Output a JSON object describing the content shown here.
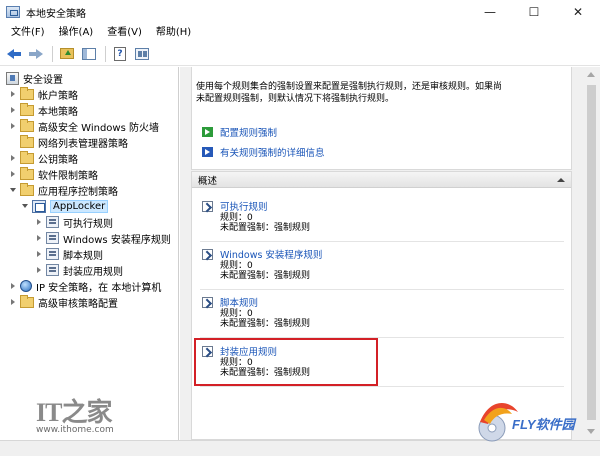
{
  "window": {
    "title": "本地安全策略",
    "minimize": "—",
    "maximize": "☐",
    "close": "✕"
  },
  "menu": [
    "文件(F)",
    "操作(A)",
    "查看(V)",
    "帮助(H)"
  ],
  "tree": {
    "root": "安全设置",
    "items": [
      "帐户策略",
      "本地策略",
      "高级安全 Windows 防火墙",
      "网络列表管理器策略",
      "公钥策略",
      "软件限制策略",
      "应用程序控制策略",
      "AppLocker",
      "可执行规则",
      "Windows 安装程序规则",
      "脚本规则",
      "封装应用规则",
      "IP 安全策略，在 本地计算机",
      "高级审核策略配置"
    ]
  },
  "description": {
    "line1": "使用每个规则集合的强制设置来配置是强制执行规则，还是审核规则。如果尚",
    "line2": "未配置规则强制，则默认情况下将强制执行规则。",
    "link_configure": "配置规则强制",
    "link_more": "有关规则强制的详细信息"
  },
  "overview": {
    "header": "概述",
    "rules": [
      {
        "title": "可执行规则",
        "count": "规则：0",
        "enforce": "未配置强制：强制规则"
      },
      {
        "title": "Windows 安装程序规则",
        "count": "规则：0",
        "enforce": "未配置强制：强制规则"
      },
      {
        "title": "脚本规则",
        "count": "规则：0",
        "enforce": "未配置强制：强制规则"
      },
      {
        "title": "封装应用规则",
        "count": "规则：0",
        "enforce": "未配置强制：强制规则"
      }
    ]
  },
  "watermark": {
    "it": "IT之家",
    "url": "www.ithome.com",
    "fly": "FLY软件园"
  },
  "colors": {
    "highlight": "#d32026",
    "link": "#1a55b8",
    "selection": "#cce8ff"
  }
}
